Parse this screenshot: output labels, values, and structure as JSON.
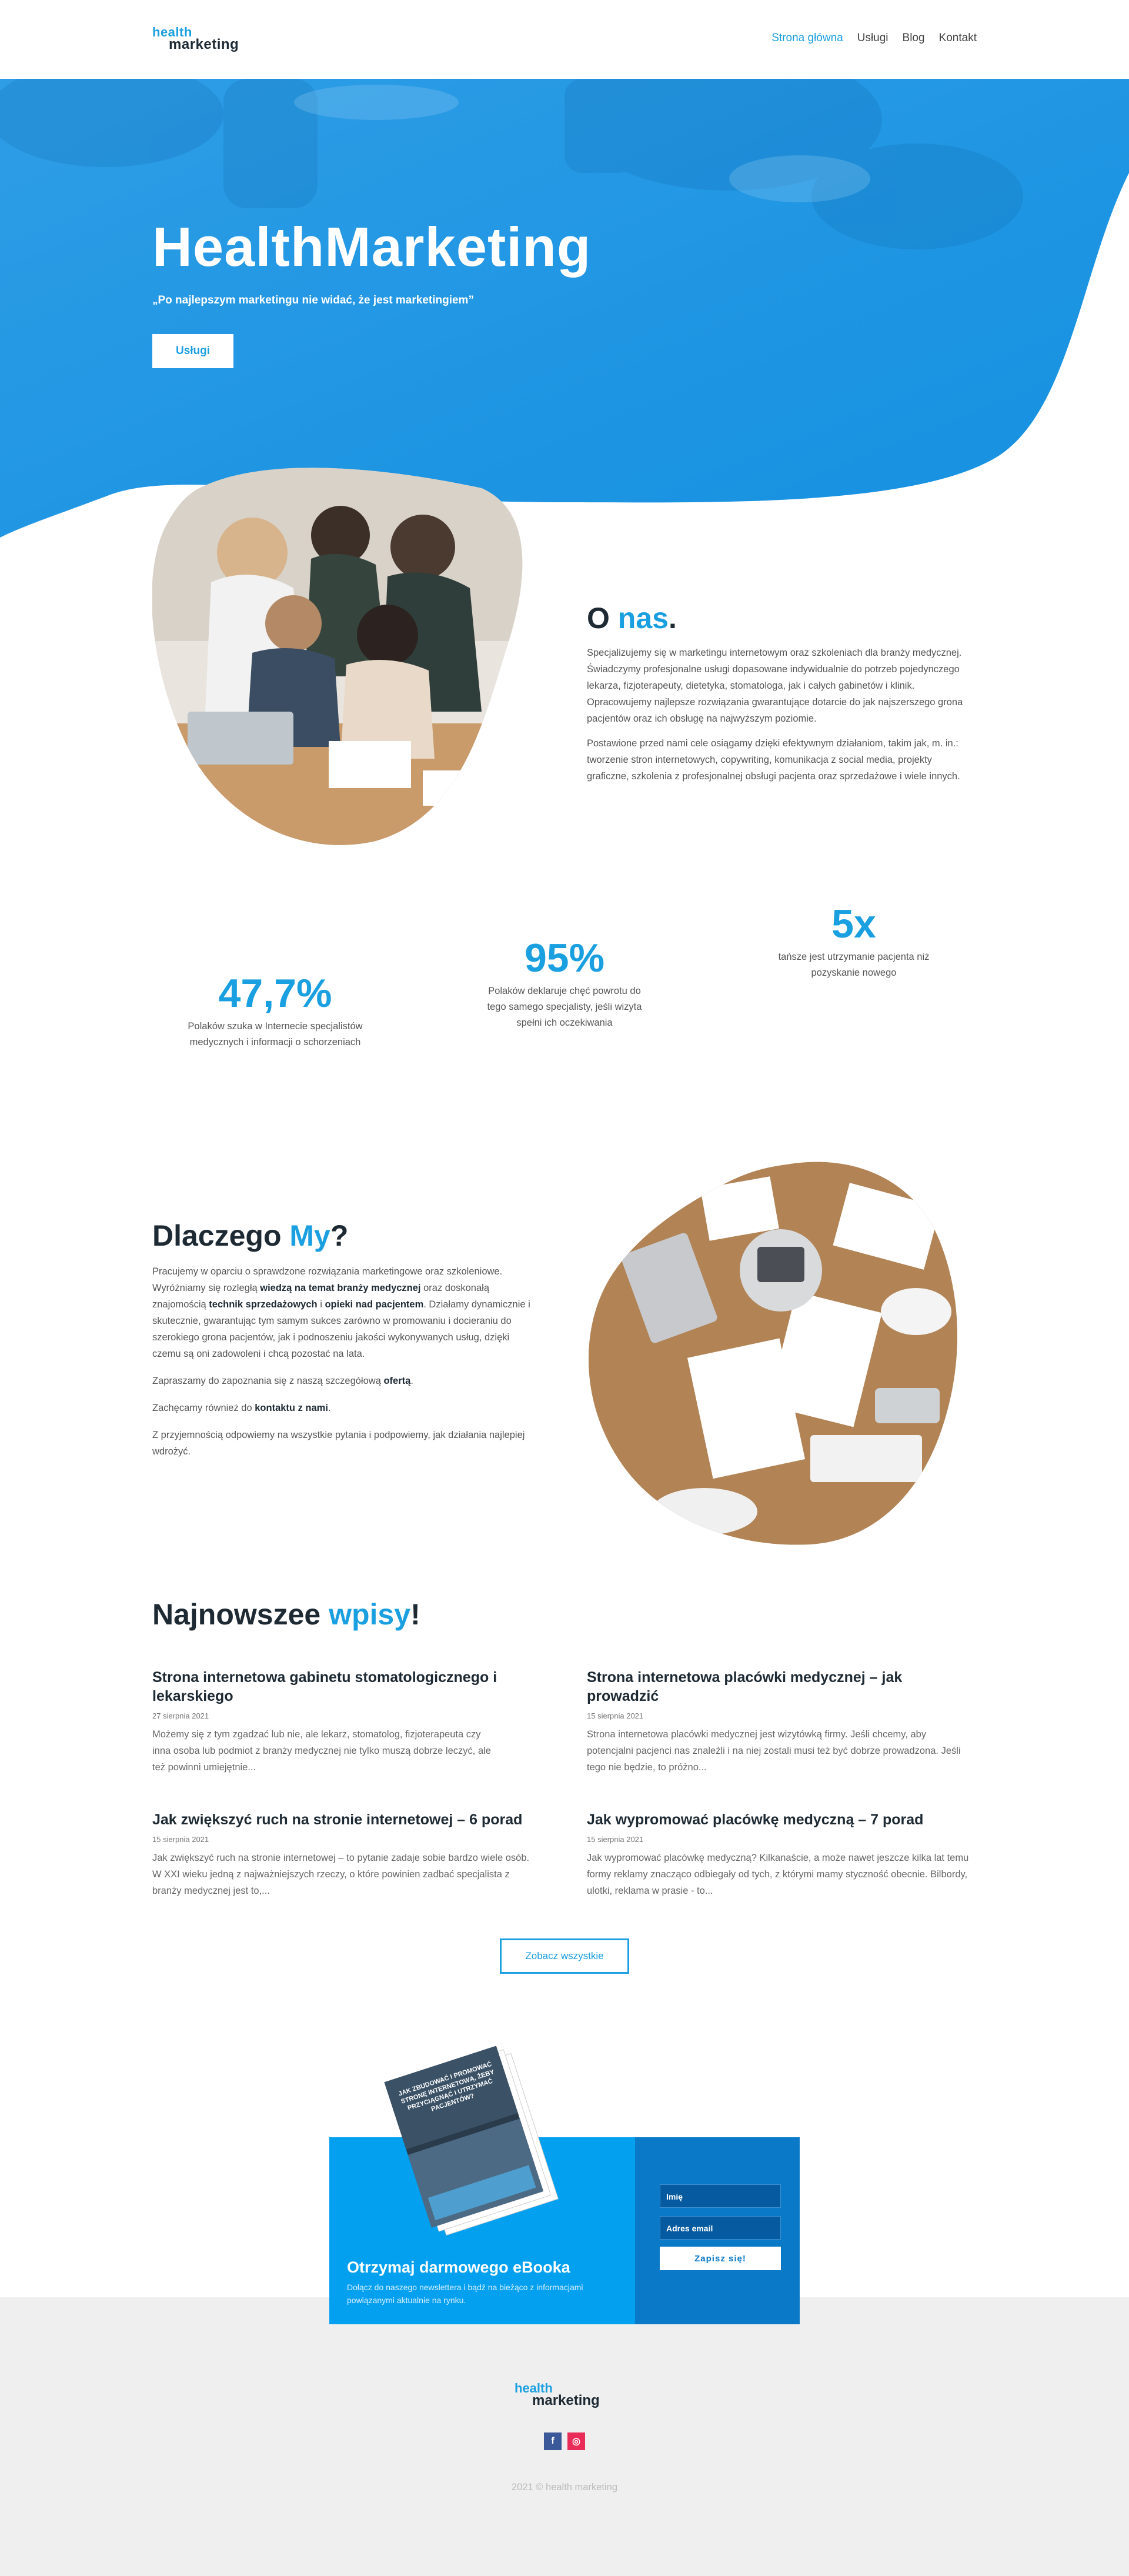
{
  "header": {
    "logo_top": "health",
    "logo_bottom": "marketing",
    "nav": [
      "Strona główna",
      "Usługi",
      "Blog",
      "Kontakt"
    ]
  },
  "hero": {
    "title": "HealthMarketing",
    "quote": "„Po najlepszym marketingu nie widać, że jest marketingiem”",
    "button": "Usługi"
  },
  "about": {
    "title_start": "O ",
    "title_accent": "nas",
    "title_end": ".",
    "p1": "Specjalizujemy się w marketingu internetowym oraz szkoleniach dla branży medycznej. Świadczymy profesjonalne usługi dopasowane indywidualnie do potrzeb pojedynczego lekarza, fizjoterapeuty, dietetyka, stomatologa, jak i całych gabinetów i klinik. Opracowujemy najlepsze rozwiązania gwarantujące dotarcie do jak najszerszego grona pacjentów oraz ich obsługę na najwyższym poziomie.",
    "p2": "Postawione przed nami cele osiągamy dzięki efektywnym działaniom, takim jak, m. in.: tworzenie stron internetowych, copywriting, komunikacja z social media, projekty graficzne, szkolenia z profesjonalnej obsługi pacjenta oraz sprzedażowe i wiele innych."
  },
  "stats": [
    {
      "num": "47,7%",
      "desc": "Polaków szuka w Internecie specjalistów medycznych i informacji o schorzeniach"
    },
    {
      "num": "95%",
      "desc": "Polaków deklaruje chęć powrotu do tego samego specjalisty, jeśli wizyta spełni ich oczekiwania"
    },
    {
      "num": "5x",
      "desc": "tańsze jest utrzymanie pacjenta niż pozyskanie nowego"
    }
  ],
  "why": {
    "title_start": "Dlaczego ",
    "title_accent": "My",
    "title_end": "?",
    "p1_a": "Pracujemy w oparciu o sprawdzone rozwiązania marketingowe oraz szkoleniowe. Wyróżniamy się rozległą ",
    "p1_b1": "wiedzą na temat branży medycznej",
    "p1_c": " oraz doskonałą znajomością ",
    "p1_b2": "technik sprzedażowych",
    "p1_d": " i ",
    "p1_b3": "opieki nad pacjentem",
    "p1_e": ". Działamy dynamicznie i skutecznie, gwarantując tym samym sukces zarówno w promowaniu i docieraniu do szerokiego grona pacjentów, jak i podnoszeniu jakości wykonywanych usług, dzięki czemu są oni zadowoleni i chcą pozostać na lata.",
    "p2_a": "Zapraszamy do zapoznania się z naszą szczegółową ",
    "p2_b": "ofertą",
    "p2_c": ".",
    "p3_a": "Zachęcamy również do ",
    "p3_b": "kontaktu z nami",
    "p3_c": ".",
    "p4": "Z przyjemnością odpowiemy na wszystkie pytania i podpowiemy, jak działania najlepiej wdrożyć."
  },
  "posts": {
    "title_start": "Najnowszee ",
    "title_accent": "wpisy",
    "title_end": "!",
    "items": [
      {
        "title": "Strona internetowa gabinetu stomatologicznego i lekarskiego",
        "date": "27 sierpnia 2021",
        "excerpt": "Możemy się z tym zgadzać lub nie, ale lekarz, stomatolog, fizjoterapeuta czy inna osoba lub podmiot z branży medycznej nie tylko muszą dobrze leczyć, ale też powinni umiejętnie..."
      },
      {
        "title": "Strona internetowa placówki medycznej – jak prowadzić",
        "date": "15 sierpnia 2021",
        "excerpt": "Strona internetowa placówki medycznej jest wizytówką firmy. Jeśli chcemy, aby potencjalni pacjenci nas znaleźli i na niej zostali musi też być dobrze prowadzona. Jeśli tego nie będzie, to próżno..."
      },
      {
        "title": "Jak zwiększyć ruch na stronie internetowej – 6 porad",
        "date": "15 sierpnia 2021",
        "excerpt": "Jak zwiększyć ruch na stronie internetowej – to pytanie zadaje sobie bardzo wiele osób. W XXI wieku jedną z najważniejszych rzeczy, o które powinien zadbać specjalista z branży medycznej jest to,..."
      },
      {
        "title": "Jak wypromować placówkę medyczną – 7 porad",
        "date": "15 sierpnia 2021",
        "excerpt": "Jak wypromować placówkę medyczną? Kilkanaście, a może nawet jeszcze kilka lat temu formy reklamy znacząco odbiegały od tych, z którymi mamy styczność obecnie. Bilbordy, ulotki, reklama w prasie - to..."
      }
    ],
    "more_button": "Zobacz wszystkie"
  },
  "newsletter": {
    "ebook_cover": "JAK ZBUDOWAĆ I PROMOWAĆ STRONĘ INTERNETOWĄ, ŻEBY PRZYCIĄGNĄĆ I UTRZYMAĆ PACJENTÓW?",
    "title": "Otrzymaj darmowego eBooka",
    "subtitle": "Dołącz do naszego newslettera i bądź na bieżąco z informacjami powiązanymi aktualnie na rynku.",
    "name_placeholder": "Imię",
    "email_placeholder": "Adres email",
    "submit": "Zapisz się!"
  },
  "footer": {
    "logo_top": "health",
    "logo_bottom": "marketing",
    "fb": "f",
    "ig": "◎",
    "copyright": "2021 © health marketing"
  },
  "colors": {
    "accent": "#1a9fe0",
    "dark": "#1e2a33",
    "footer_bg": "#efefef"
  }
}
